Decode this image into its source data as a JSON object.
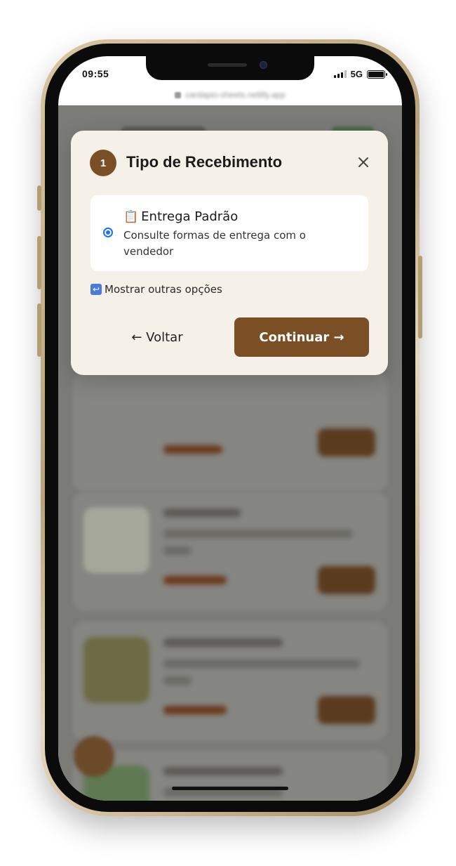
{
  "status_bar": {
    "time": "09:55",
    "network": "5G",
    "signal_icon": "signal-bars-icon",
    "battery_icon": "battery-icon",
    "battery_level": 1.0
  },
  "browser": {
    "url": "cardapio-sheets.netlify.app"
  },
  "modal": {
    "step_number": "1",
    "title": "Tipo de Recebimento",
    "close_icon": "close-icon",
    "option": {
      "icon": "📋",
      "icon_name": "clipboard-icon",
      "title": "Entrega Padrão",
      "description": "Consulte formas de entrega com o vendedor",
      "selected": true
    },
    "more_options": {
      "icon": "↩",
      "icon_name": "return-icon",
      "label": "Mostrar outras opções"
    },
    "back_button": "← Voltar",
    "continue_button": "Continuar →"
  },
  "colors": {
    "accent": "#7a4f25",
    "modal_bg": "#f6f1e8",
    "radio": "#1a73e8",
    "overlay": "#7b7b78"
  }
}
